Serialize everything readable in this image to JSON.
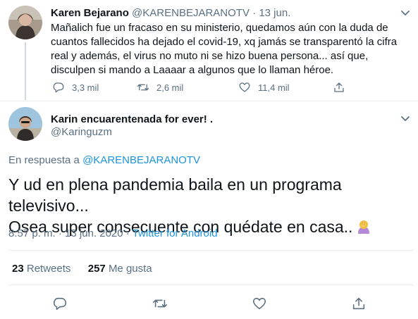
{
  "tweet1": {
    "name": "Karen Bejarano",
    "handle": "@KARENBEJARANOTV",
    "separator": "·",
    "date": "13 jun.",
    "text": "Mañalich fue un fracaso en su ministerio, quedamos aún con la duda de cuantos fallecidos ha dejado el covid-19, xq jamás se transparentó la cifra real y además, el virus no muto ni se hizo buena persona... así que, disculpen si mando a Laaaar a algunos que lo llaman héroe.",
    "replies": "3,3 mil",
    "retweets": "2,6 mil",
    "likes": "11,4 mil"
  },
  "tweet2": {
    "name": "Karin encuarentenada for ever! .",
    "handle": "@Karinguzm",
    "reply_prefix": "En respuesta a ",
    "reply_to": "@KARENBEJARANOTV",
    "text_line1": "Y ud en plena pandemia baila en un programa televisivo...",
    "text_line2": "Osea super consecuente con quédate en casa..",
    "time": "8:57 p. m.",
    "meta_sep": " · ",
    "date": "13 jun. 2020",
    "source": "Twitter for Android",
    "retweets_count": "23",
    "retweets_label": "Retweets",
    "likes_count": "257",
    "likes_label": "Me gusta"
  },
  "colors": {
    "text": "#0f1419",
    "muted": "#5b7083",
    "link": "#1b95e0",
    "divider": "#ebeef0"
  },
  "icons": [
    "reply-icon",
    "retweet-icon",
    "like-icon",
    "share-icon",
    "more-chevron-icon",
    "woman-facepalming-emoji"
  ]
}
